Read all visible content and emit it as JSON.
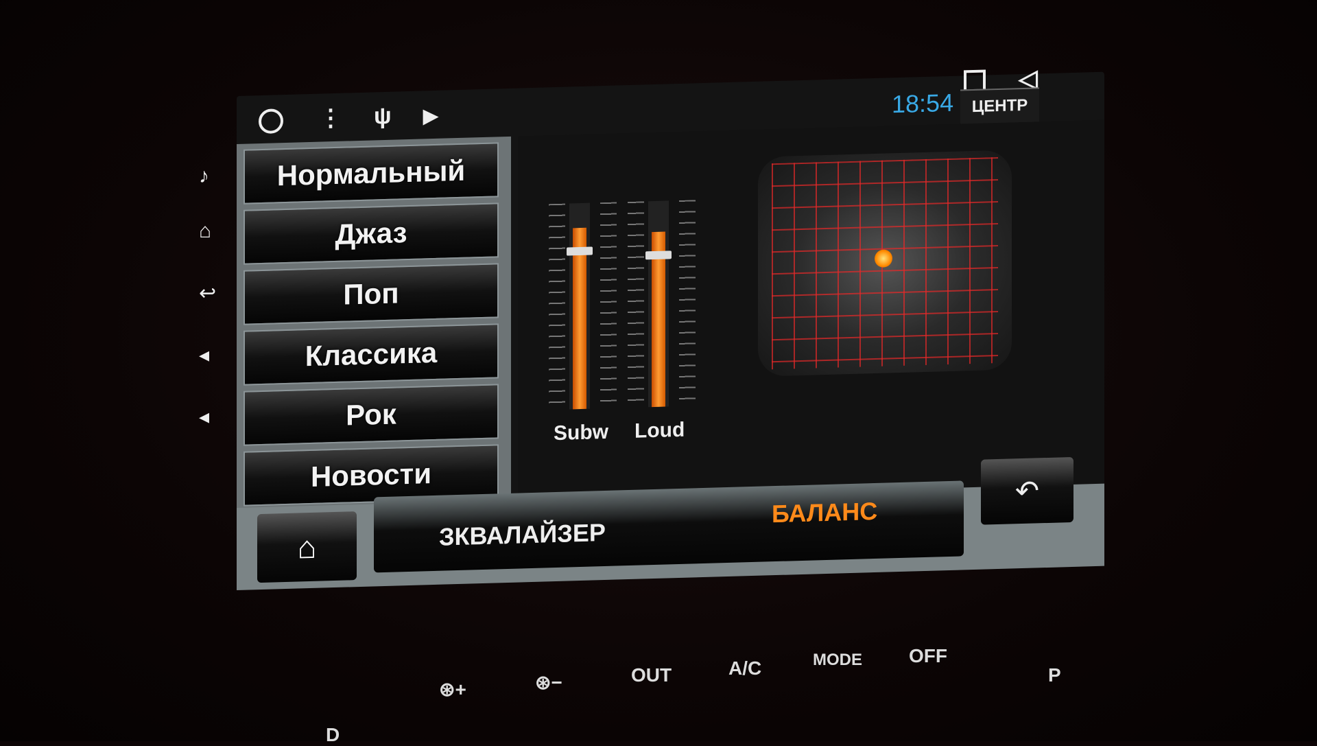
{
  "status_bar": {
    "time": "18:54",
    "icons": [
      "home-circle-icon",
      "menu-dots-icon",
      "usb-icon",
      "play-store-icon",
      "recent-apps-square-icon",
      "back-triangle-icon"
    ]
  },
  "presets": [
    "Нормальный",
    "Джаз",
    "Поп",
    "Классика",
    "Рок",
    "Новости"
  ],
  "sliders": [
    {
      "label": "Subw",
      "level_percent": 88
    },
    {
      "label": "Loud",
      "level_percent": 85
    }
  ],
  "balance": {
    "center_label": "ЦЕНТР"
  },
  "tabs": {
    "equalizer": "ЗКВАЛАЙЗЕР",
    "balance": "БАЛАНС",
    "active": "balance"
  },
  "colors": {
    "accent": "#ff8a1a",
    "time": "#39a9e6"
  },
  "dashboard": {
    "fan_plus": "+",
    "fan_minus": "−",
    "out": "OUT",
    "ac": "A/C",
    "mode": "MODE",
    "off": "OFF",
    "p": "P",
    "d": "D"
  }
}
